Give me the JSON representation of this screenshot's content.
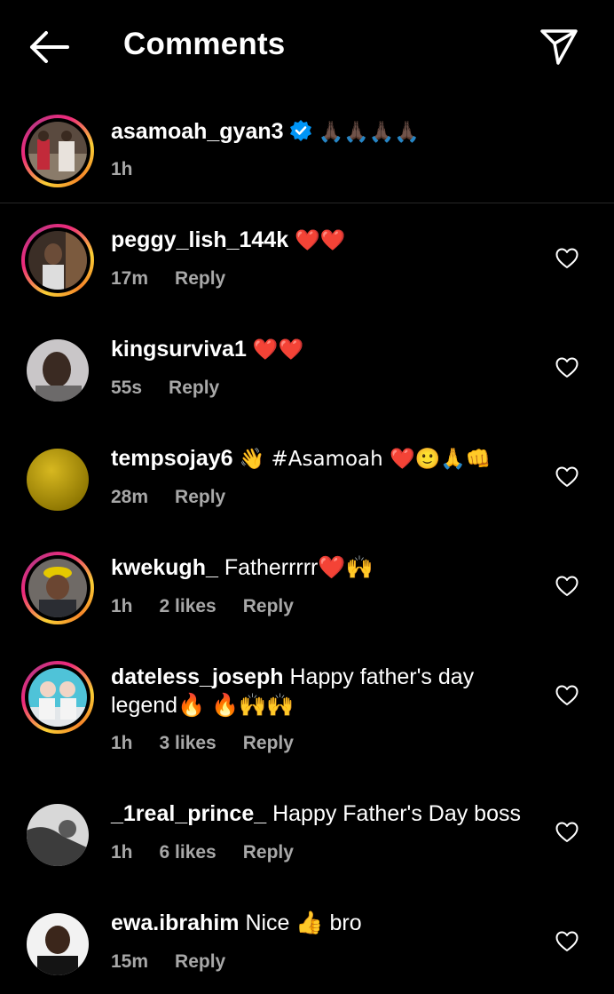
{
  "header": {
    "title": "Comments",
    "back_icon": "arrow-left-icon",
    "send_icon": "paper-plane-icon"
  },
  "caption": {
    "username": "asamoah_gyan3",
    "verified": true,
    "text": "🙏🏿🙏🏿🙏🏿🙏🏿",
    "time": "1h"
  },
  "comments": [
    {
      "username": "peggy_lish_144k",
      "text": "❤️❤️",
      "time": "17m",
      "likes": "",
      "reply": "Reply"
    },
    {
      "username": "kingsurviva1",
      "text": "❤️❤️",
      "time": "55s",
      "likes": "",
      "reply": "Reply"
    },
    {
      "username": "tempsojay6",
      "text": "👋 #Asamoah ❤️🙂🙏👊",
      "time": "28m",
      "likes": "",
      "reply": "Reply"
    },
    {
      "username": "kwekugh_",
      "text": "Fatherrrrr❤️🙌",
      "time": "1h",
      "likes": "2 likes",
      "reply": "Reply"
    },
    {
      "username": "dateless_joseph",
      "text": "Happy father's day legend🔥 🔥🙌🙌",
      "time": "1h",
      "likes": "3 likes",
      "reply": "Reply"
    },
    {
      "username": "_1real_prince_",
      "text": "Happy Father's Day boss",
      "time": "1h",
      "likes": "6 likes",
      "reply": "Reply"
    },
    {
      "username": "ewa.ibrahim",
      "text": "Nice 👍 bro",
      "time": "15m",
      "likes": "",
      "reply": "Reply"
    }
  ],
  "colors": {
    "background": "#000000",
    "text": "#ffffff",
    "meta": "#a8a8a8",
    "verified": "#0095f6"
  }
}
